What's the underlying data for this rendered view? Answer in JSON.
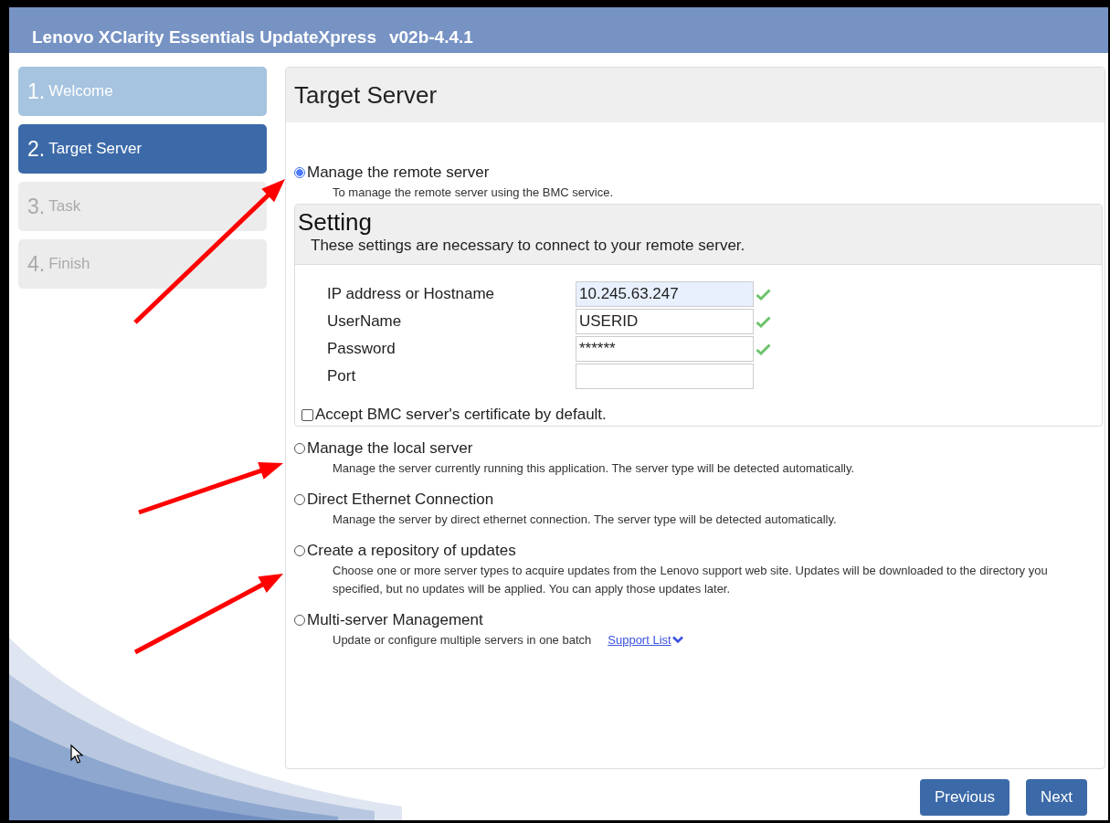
{
  "window": {
    "title": "Lenovo XClarity Essentials UpdateXpress",
    "version": "v02b-4.4.1"
  },
  "steps": [
    {
      "number": "1.",
      "label": "Welcome",
      "selected": false,
      "completed": true
    },
    {
      "number": "2.",
      "label": "Target Server",
      "selected": true,
      "completed": false
    },
    {
      "number": "3.",
      "label": "Task",
      "selected": false,
      "completed": false
    },
    {
      "number": "4.",
      "label": "Finish",
      "selected": false,
      "completed": false
    }
  ],
  "page_title": "Target Server",
  "options": [
    {
      "label": "Manage the remote server",
      "description": "To manage the remote server using the BMC service.",
      "selected": true,
      "settings": {
        "title": "Setting",
        "subtitle": "These settings are necessary to connect to your remote server.",
        "fields": [
          {
            "label": "IP address or Hostname",
            "value": "10.245.63.247",
            "valid": true,
            "autofilled": true
          },
          {
            "label": "UserName",
            "value": "USERID",
            "valid": true,
            "autofilled": false
          },
          {
            "label": "Password",
            "value": "******",
            "valid": true,
            "autofilled": false
          },
          {
            "label": "Port",
            "valid": false,
            "autofilled": false
          }
        ],
        "checkbox": {
          "label": "Accept BMC server's certificate by default.",
          "checked": false
        }
      }
    },
    {
      "label": "Manage the local server",
      "description": "Manage the server currently running this application. The server type will be detected automatically.",
      "selected": false
    },
    {
      "label": "Direct Ethernet Connection",
      "description": "Manage the server by direct ethernet connection. The server type will be detected automatically.",
      "selected": false
    },
    {
      "label": "Create a repository of updates",
      "description": "Choose one or more server types to acquire updates from the Lenovo support web site. Updates will be downloaded to the directory you specified, but no updates will be applied. You can apply those updates later.",
      "selected": false
    },
    {
      "label": "Multi-server Management",
      "description": "Update or configure multiple servers in one batch",
      "link": "Support List",
      "selected": false
    }
  ],
  "buttons": [
    "Previous",
    "Next"
  ]
}
